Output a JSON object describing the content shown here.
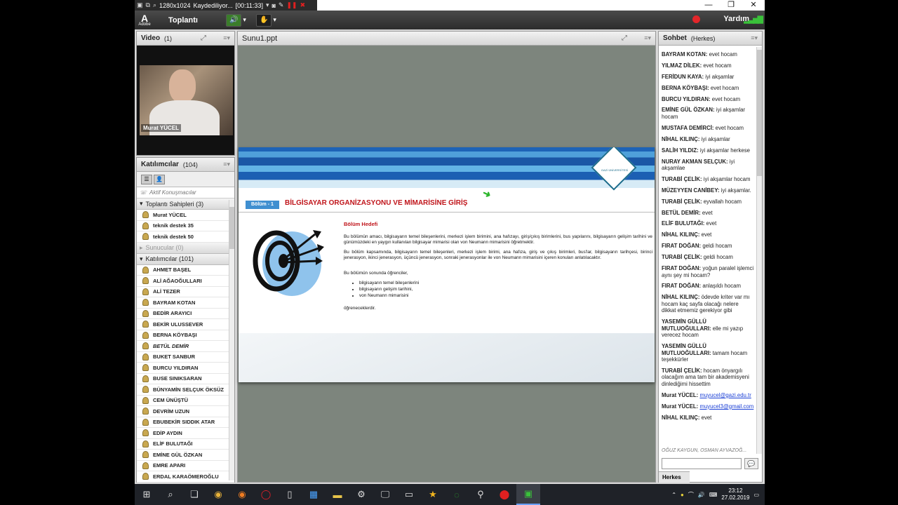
{
  "recorder": {
    "resolution": "1280x1024",
    "status": "Kaydediliyor...",
    "time": "[00:11:33]"
  },
  "app": {
    "vendor": "Adobe",
    "meeting_menu": "Toplantı",
    "help_label": "Yardım"
  },
  "video": {
    "title": "Video",
    "count": "(1)",
    "presenter_name": "Murat YÜCEL"
  },
  "attendees": {
    "title": "Katılımcılar",
    "count": "(104)",
    "active_speakers": "Aktif Konuşmacılar",
    "hosts_header": "Toplantı Sahipleri (3)",
    "hosts": [
      "Murat YÜCEL",
      "teknik destek 35",
      "teknik destek 50"
    ],
    "presenters_header": "Sunucular (0)",
    "participants_header": "Katılımcılar (101)",
    "participants": [
      "AHMET BAŞEL",
      "ALİ AĞAOĞULLARI",
      "ALİ TEZER",
      "BAYRAM KOTAN",
      "BEDİR ARAYICI",
      "BEKİR ULUSSEVER",
      "BERNA KÖYBAŞI",
      "BETÜL DEMİR",
      "BUKET SANBUR",
      "BURCU YILDIRAN",
      "BUSE SINIKSARAN",
      "BÜNYAMİN SELÇUK ÖKSÜZ",
      "CEM ÜNÜŞTÜ",
      "DEVRİM UZUN",
      "EBUBEKİR SIDDIK ATAR",
      "EDİP AYDIN",
      "ELİF BULUTAĞI",
      "EMİNE GÜL ÖZKAN",
      "EMRE APARI",
      "ERDAL KARAÖMEROĞLU"
    ]
  },
  "share": {
    "title": "Sunu1.ppt",
    "slide": {
      "logo_text": "GAZİ ÜNİVERSİTESİ",
      "chapter_tag": "Bölüm - 1",
      "chapter_title": "BİLGİSAYAR ORGANİZASYONU VE MİMARİSİNE GİRİŞ",
      "section_heading": "Bölüm Hedefi",
      "para1": "Bu bölümün amacı, bilgisayarın temel bileşenlerini, merkezi işlem birimini, ana hafızayı, giriş/çıkış birimlerini, bus yapılarını, bilgisayarın gelişim tarihini ve günümüzdeki en yaygın kullanılan bilgisayar mimarisi olan von Neumann mimarisini öğretmektir.",
      "para2": "Bu bölüm kapsamında, bilgisayarın temel bileşenleri, merkezi işlem birimi, ana hafıza, giriş ve çıkış birimleri, bus'lar, bilgisayarın tarihçesi, birinci jenerasyon, ikinci jenerasyon, üçüncü jenerasyon, sonraki jenerasyonlar ile von Neumann mimarisini içeren konuları anlatılacaktır.",
      "lead": "Bu bölümün sonunda öğrenciler,",
      "bullets": [
        "bilgisayarın temel bileşenlerini",
        "bilgisayarın gelişim tarihini,",
        "von Neumann mimarisini"
      ],
      "closing": "öğreneceklerdir."
    }
  },
  "chat": {
    "title": "Sohbet",
    "scope": "(Herkes)",
    "messages": [
      {
        "name": "BAYRAM KOTAN:",
        "text": " evet hocam"
      },
      {
        "name": "YILMAZ DİLEK:",
        "text": " evet hocam"
      },
      {
        "name": "FERİDUN KAYA:",
        "text": " iyi akşamlar"
      },
      {
        "name": "BERNA KÖYBAŞI:",
        "text": " evet hocam"
      },
      {
        "name": "BURCU YILDIRAN:",
        "text": " evet hocam"
      },
      {
        "name": "EMİNE GÜL ÖZKAN:",
        "text": " iyi akşamlar hocam"
      },
      {
        "name": "MUSTAFA DEMİRCİ:",
        "text": " evet hocam"
      },
      {
        "name": "NİHAL KILINÇ:",
        "text": " iyi akşamlar"
      },
      {
        "name": "SALİH YILDIZ:",
        "text": " iyi akşamlar herkese"
      },
      {
        "name": "NURAY AKMAN SELÇUK:",
        "text": " iyi akşamlae"
      },
      {
        "name": "TURABİ ÇELİK:",
        "text": " iyi akşamlar hocam"
      },
      {
        "name": "MÜZEYYEN CANİBEY:",
        "text": " iyi akşamlar."
      },
      {
        "name": "TURABİ ÇELİK:",
        "text": " eyvallah hocam"
      },
      {
        "name": "BETÜL DEMİR:",
        "text": " evet"
      },
      {
        "name": "ELİF BULUTAĞI:",
        "text": " evet"
      },
      {
        "name": "NİHAL KILINÇ:",
        "text": " evet"
      },
      {
        "name": "FIRAT DOĞAN:",
        "text": " geldi hocam"
      },
      {
        "name": "TURABİ ÇELİK:",
        "text": " geldi hocam"
      },
      {
        "name": "FIRAT DOĞAN:",
        "text": " yoğun paralel işlemci aynı şey mi hocam?"
      },
      {
        "name": "FIRAT DOĞAN:",
        "text": " anlaşıldı hocam"
      },
      {
        "name": "NİHAL KILINÇ:",
        "text": " ödevde kriter var mı hocam kaç sayfa olacağı nelere dikkat etmemiz gerekiyor gibi"
      },
      {
        "name": "YASEMİN GÜLLÜ MUTLUOĞULLARI:",
        "text": " elle mi yazıp verecez hocam"
      },
      {
        "name": "YASEMİN GÜLLÜ MUTLUOĞULLARI:",
        "text": " tamam hocam teşekkürler"
      },
      {
        "name": "TURABİ ÇELİK:",
        "text": " hocam önyargılı olacağım ama tam bir akademisyeni dinlediğimi hissettim"
      },
      {
        "name": "Murat YÜCEL:",
        "text": " ",
        "link": "muyucel@gazi.edu.tr"
      },
      {
        "name": "Murat YÜCEL:",
        "text": " ",
        "link": "muyucel3@gmail.com"
      },
      {
        "name": "NİHAL KILINÇ:",
        "text": " evet"
      }
    ],
    "typing_notice": "OĞUZ KAYGUN, OSMAN AYVAZOĞ...",
    "tab_label": "Herkes"
  },
  "taskbar": {
    "time": "23:12",
    "date": "27.02.2019"
  },
  "colors": {
    "slide_red": "#c0141a",
    "banner_blue": "#1a57a6",
    "link_blue": "#1a3fd6"
  }
}
